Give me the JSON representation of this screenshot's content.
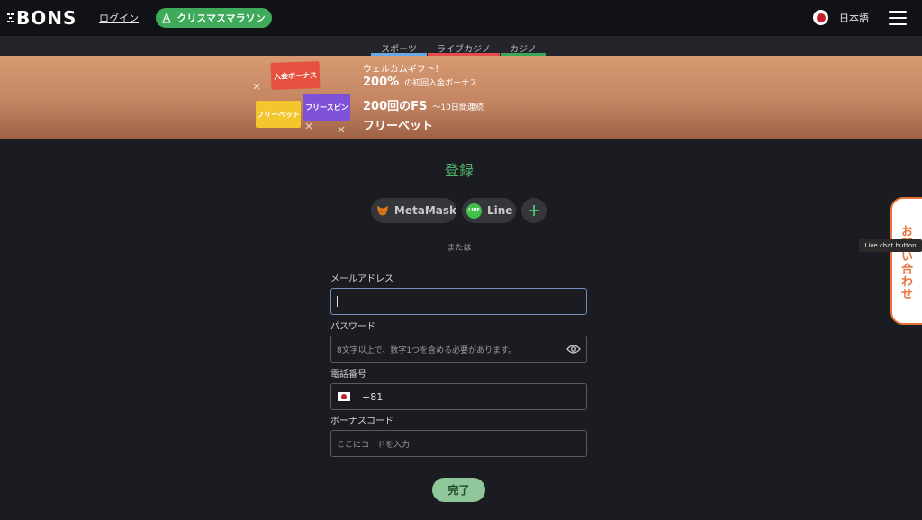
{
  "header": {
    "logo": "BONS",
    "login_label": "ログイン",
    "event_button": "クリスマスマラソン",
    "language": "日本語"
  },
  "tabs": [
    {
      "label": "スポーツ",
      "color": "#6aa7e6"
    },
    {
      "label": "ライブカジノ",
      "color": "#e54b4b"
    },
    {
      "label": "カジノ",
      "color": "#3da55a"
    }
  ],
  "banner": {
    "tile_deposit": "入金ボーナス",
    "tile_freebet": "フリーベット",
    "tile_freespin": "フリースピン",
    "subtitle": "ウェルカムギフト！",
    "line1_big": "200%",
    "line1_small": "の初回入金ボーナス",
    "line2_big": "200回のFS",
    "line2_small": "〜10日間連続",
    "line3": "フリーベット"
  },
  "register": {
    "title": "登録",
    "social": [
      {
        "label": "MetaMask",
        "icon": "metamask-fox-icon"
      },
      {
        "label": "Line",
        "icon": "line-icon"
      }
    ],
    "more_icon": "plus-icon",
    "divider": "または",
    "email_label": "メールアドレス",
    "password_label": "パスワード",
    "password_placeholder": "8文字以上で、数字1つを含める必要があります。",
    "phone_label": "電話番号",
    "phone_code": "+81",
    "bonus_label": "ボーナスコード",
    "bonus_placeholder": "ここにコードを入力",
    "submit": "完了"
  },
  "live_chat": {
    "label": "お問い合わせ",
    "tooltip": "Live chat button"
  },
  "colors": {
    "accent_green": "#3faa5a",
    "chat_orange": "#e7743d"
  }
}
